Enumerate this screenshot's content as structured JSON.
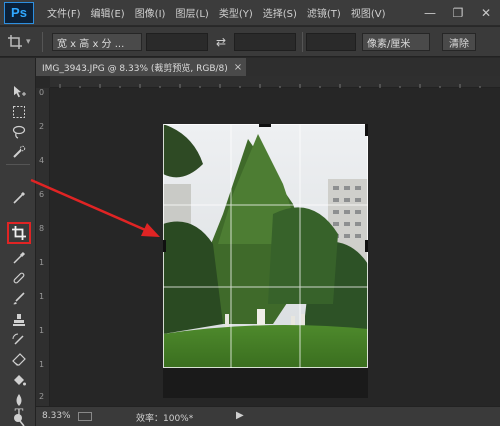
{
  "app": {
    "logo": "Ps"
  },
  "menu": {
    "items": [
      "文件(F)",
      "编辑(E)",
      "图像(I)",
      "图层(L)",
      "类型(Y)",
      "选择(S)",
      "滤镜(T)",
      "视图(V)"
    ]
  },
  "window_controls": {
    "minimize": "—",
    "restore": "❐",
    "close": "✕"
  },
  "options_bar": {
    "ratio_select": "宽 x 高 x 分 ...",
    "swap_icon": "⇄",
    "units_select": "像素/厘米",
    "clear_button": "清除"
  },
  "document_tab": {
    "title": "IMG_3943.JPG @ 8.33% (裁剪预览, RGB/8)",
    "close": "×"
  },
  "rulers": {
    "horizontal": [],
    "vertical": [
      "0",
      "2",
      "4",
      "6",
      "8",
      "1",
      "1",
      "1",
      "1",
      "2"
    ]
  },
  "status_bar": {
    "zoom": "8.33%",
    "efficiency": "效率：100%*",
    "arrow": "▶"
  },
  "tools": [
    "move-tool",
    "marquee-tool",
    "lasso-tool",
    "quick-selection-tool",
    "crop-tool",
    "eyedropper-tool",
    "healing-brush-tool",
    "brush-tool",
    "clone-stamp-tool",
    "history-brush-tool",
    "eraser-tool",
    "gradient-tool",
    "paint-bucket-tool",
    "blur-tool",
    "dodge-tool",
    "pen-tool",
    "type-tool"
  ],
  "colors": {
    "annotation": "#e02424",
    "accent": "#30a8ff"
  }
}
